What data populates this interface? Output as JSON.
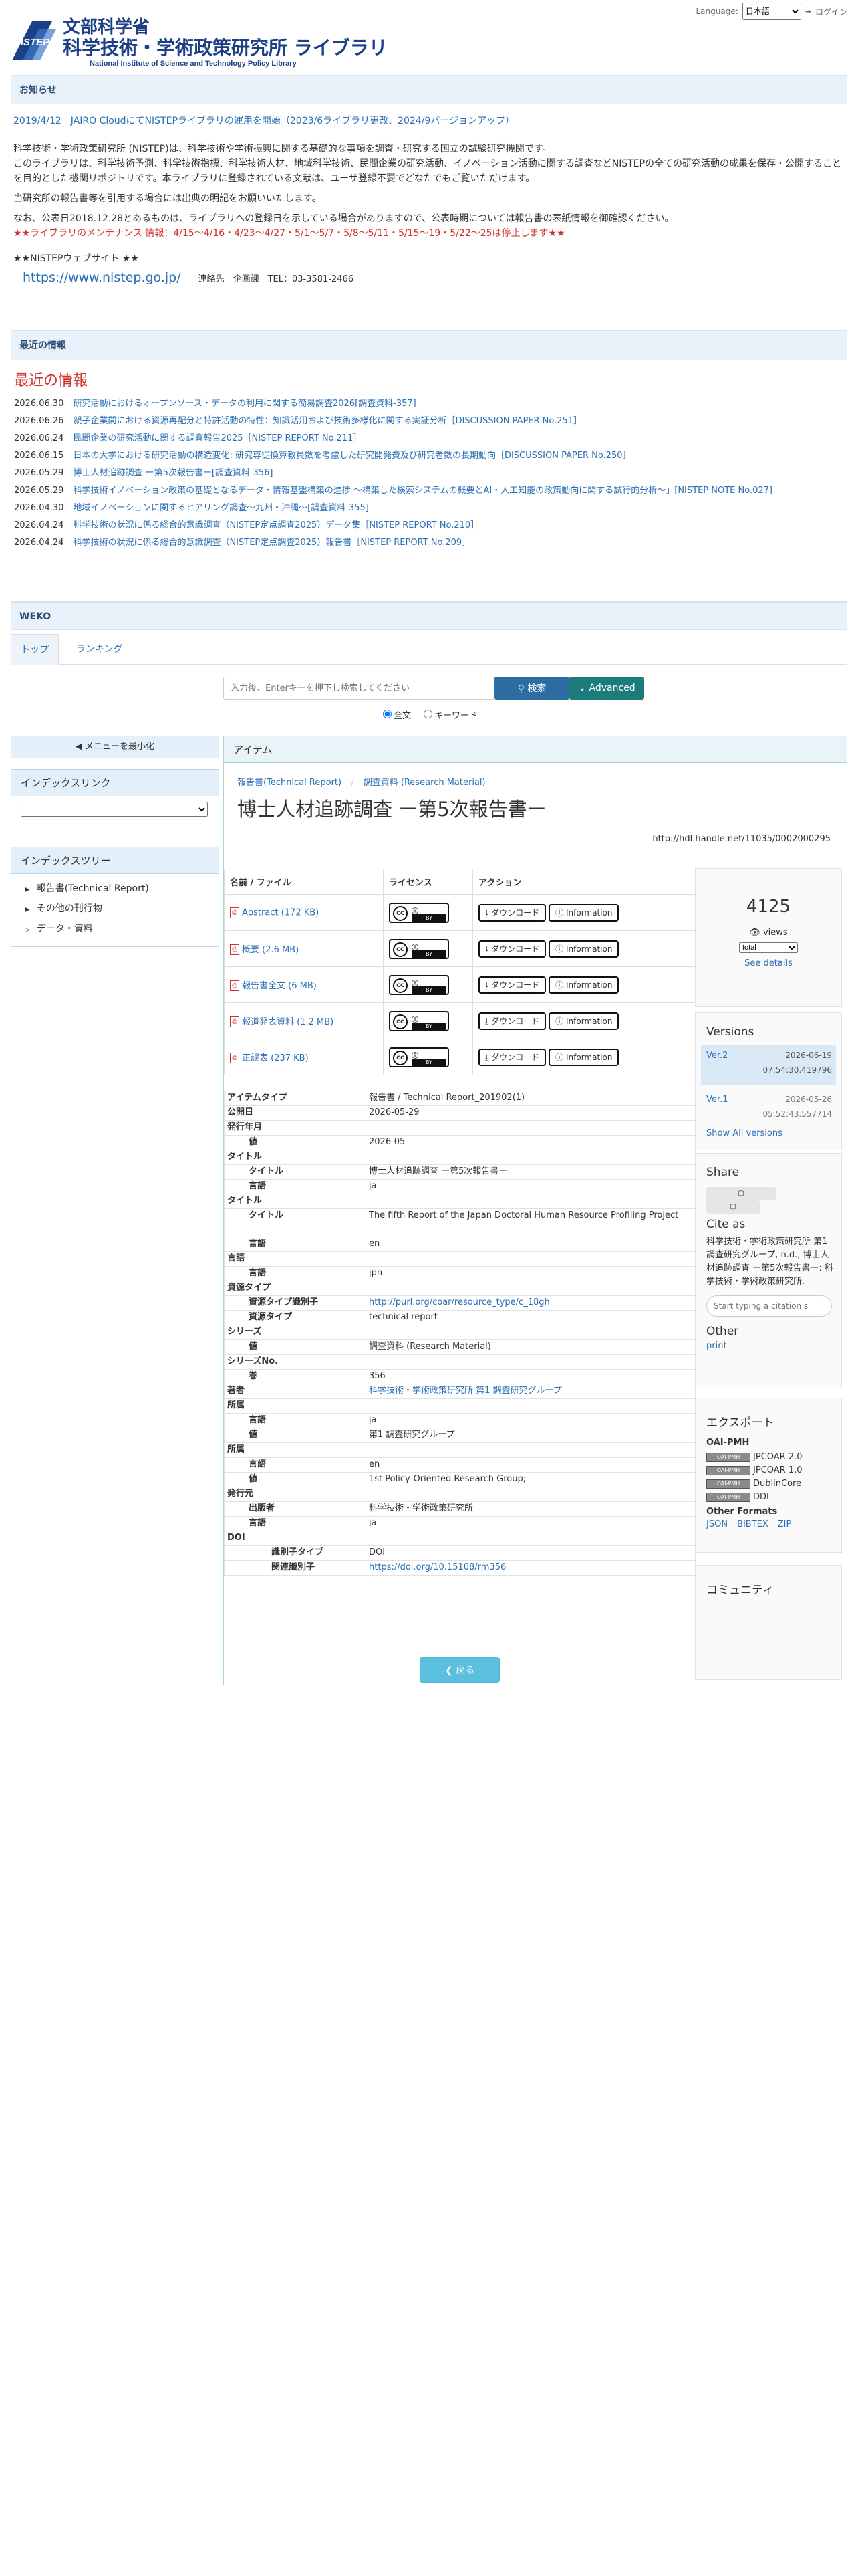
{
  "topbar": {
    "language_label": "Language:",
    "language_value": "日本語",
    "login": "ログイン"
  },
  "logo": {
    "line1": "文部科学省",
    "line2": "科学技術・学術政策研究所 ライブラリ",
    "line3": "National Institute of Science and Technology Policy Library"
  },
  "notice": {
    "heading": "お知らせ",
    "update": "2019/4/12　JAIRO CloudにてNISTEPライブラリの運用を開始（2023/6ライブラリ更改、2024/9バージョンアップ）",
    "desc1": "科学技術・学術政策研究所 (NISTEP)は、科学技術や学術振興に関する基礎的な事項を調査・研究する国立の試験研究機関です。",
    "desc2": "このライブラリは、科学技術予測、科学技術指標、科学技術人材、地域科学技術、民間企業の研究活動、イノベーション活動に関する調査などNISTEPの全ての研究活動の成果を保存・公開することを目的とした機関リポジトリです。本ライブラリに登録されている文献は、ユーザ登録不要でどなたでもご覧いただけます。",
    "desc3": "当研究所の報告書等を引用する場合には出典の明記をお願いいたします。",
    "desc4": "なお、公表日2018.12.28とあるものは、ライブラリへの登録日を示している場合がありますので、公表時期については報告書の表紙情報を御確認ください。",
    "maint": "★★ライブラリのメンテナンス 情報：4/15～4/16・4/23～4/27・5/1～5/7・5/8～5/11・5/15～19・5/22～25は停止します★★",
    "site_label": "★★NISTEPウェブサイト ★★",
    "site_url": "https://www.nistep.go.jp/",
    "contact": "連絡先　企画課　TEL：03-3581-2466"
  },
  "news": {
    "heading": "最近の情報",
    "title": "最近の情報",
    "items": [
      {
        "date": "2026.06.30",
        "text": "研究活動におけるオープンソース・データの利用に関する簡易調査2026[調査資料-357]"
      },
      {
        "date": "2026.06.26",
        "text": "親子企業間における資源再配分と特許活動の特性：知識活用および技術多様化に関する実証分析［DISCUSSION PAPER No.251］"
      },
      {
        "date": "2026.06.24",
        "text": "民間企業の研究活動に関する調査報告2025［NISTEP REPORT No.211］"
      },
      {
        "date": "2026.06.15",
        "text": "日本の大学における研究活動の構造変化: 研究専従換算教員数を考慮した研究開発費及び研究者数の長期動向［DISCUSSION PAPER No.250］"
      },
      {
        "date": "2026.05.29",
        "text": "博士人材追跡調査 ー第5次報告書ー[調査資料-356]"
      },
      {
        "date": "2026.05.29",
        "text": "科学技術イノベーション政策の基礎となるデータ・情報基盤構築の進捗 ～構築した検索システムの概要とAI・人工知能の政策動向に関する試行的分析～」[NISTEP NOTE No.027]"
      },
      {
        "date": "2026.04.30",
        "text": "地域イノベーションに関するヒアリング調査～九州・沖縄～[調査資料-355]"
      },
      {
        "date": "2026.04.24",
        "text": "科学技術の状況に係る総合的意識調査（NISTEP定点調査2025）データ集［NISTEP REPORT No.210］"
      },
      {
        "date": "2026.04.24",
        "text": "科学技術の状況に係る総合的意識調査（NISTEP定点調査2025）報告書［NISTEP REPORT No.209］"
      }
    ]
  },
  "weko": {
    "heading": "WEKO",
    "tabs": [
      "トップ",
      "ランキング"
    ]
  },
  "search": {
    "placeholder": "入力後、Enterキーを押下し検索してください",
    "button": "検索",
    "advanced": "Advanced",
    "radio1": "全文",
    "radio2": "キーワード"
  },
  "sidebar": {
    "collapse": "◀ メニューを最小化",
    "index_link": "インデックスリンク",
    "index_tree": "インデックスツリー",
    "tree": [
      "報告書(Technical Report)",
      "その他の刊行物",
      "データ・資料"
    ]
  },
  "item": {
    "heading": "アイテム",
    "breadcrumb": [
      "報告書(Technical Report)",
      "調査資料 (Research Material)"
    ],
    "title": "博士人材追跡調査 ー第5次報告書ー",
    "handle": "http://hdl.handle.net/11035/0002000295",
    "file_headers": [
      "名前 / ファイル",
      "ライセンス",
      "アクション"
    ],
    "files": [
      "Abstract (172 KB)",
      "概要 (2.6 MB)",
      "報告書全文 (6 MB)",
      "報道発表資料 (1.2 MB)",
      "正誤表 (237 KB)"
    ],
    "download": "ダウンロード",
    "information": "Information",
    "license_top": "BY",
    "metadata": [
      {
        "k": "アイテムタイプ",
        "v": "報告書 / Technical Report_201902(1)",
        "lvl": 1
      },
      {
        "k": "公開日",
        "v": "2026-05-29",
        "lvl": 1
      },
      {
        "k": "発行年月",
        "v": "",
        "lvl": 1
      },
      {
        "k": "値",
        "v": "2026-05",
        "lvl": 2
      },
      {
        "k": "タイトル",
        "v": "",
        "lvl": 1
      },
      {
        "k": "タイトル",
        "v": "博士人材追跡調査 ー第5次報告書ー",
        "lvl": 2
      },
      {
        "k": "言語",
        "v": "ja",
        "lvl": 2
      },
      {
        "k": "タイトル",
        "v": "",
        "lvl": 1
      },
      {
        "k": "タイトル",
        "v": "The fifth Report of the Japan Doctoral Human Resource Profiling Project",
        "lvl": 2,
        "tall": true
      },
      {
        "k": "言語",
        "v": "en",
        "lvl": 2
      },
      {
        "k": "言語",
        "v": "",
        "lvl": 1
      },
      {
        "k": "言語",
        "v": "jpn",
        "lvl": 2
      },
      {
        "k": "資源タイプ",
        "v": "",
        "lvl": 1
      },
      {
        "k": "資源タイプ識別子",
        "v": "http://purl.org/coar/resource_type/c_18gh",
        "lvl": 2,
        "link": true
      },
      {
        "k": "資源タイプ",
        "v": "technical report",
        "lvl": 2
      },
      {
        "k": "シリーズ",
        "v": "",
        "lvl": 1
      },
      {
        "k": "値",
        "v": "調査資料 (Research Material)",
        "lvl": 2
      },
      {
        "k": "シリーズNo.",
        "v": "",
        "lvl": 1
      },
      {
        "k": "巻",
        "v": "356",
        "lvl": 2
      },
      {
        "k": "著者",
        "v": "科学技術・学術政策研究所 第1 調査研究グループ",
        "lvl": 1,
        "link": true
      },
      {
        "k": "所属",
        "v": "",
        "lvl": 1
      },
      {
        "k": "言語",
        "v": "ja",
        "lvl": 2
      },
      {
        "k": "値",
        "v": "第1 調査研究グループ",
        "lvl": 2
      },
      {
        "k": "所属",
        "v": "",
        "lvl": 1
      },
      {
        "k": "言語",
        "v": "en",
        "lvl": 2
      },
      {
        "k": "値",
        "v": "1st Policy-Oriented Research Group;",
        "lvl": 2
      },
      {
        "k": "発行元",
        "v": "",
        "lvl": 1
      },
      {
        "k": "出版者",
        "v": "科学技術・学術政策研究所",
        "lvl": 2
      },
      {
        "k": "言語",
        "v": "ja",
        "lvl": 2
      },
      {
        "k": "DOI",
        "v": "",
        "lvl": 1
      },
      {
        "k": "識別子タイプ",
        "v": "DOI",
        "lvl": 3
      },
      {
        "k": "関連識別子",
        "v": "https://doi.org/10.15108/rm356",
        "lvl": 3,
        "link": true
      }
    ],
    "back": "戻る"
  },
  "stats": {
    "count": "4125",
    "views_label": "views",
    "select": "total",
    "see_details": "See details"
  },
  "versions": {
    "heading": "Versions",
    "v2": "Ver.2",
    "v2_date": "2026-06-19",
    "v2_time": "07:54:30.419796",
    "v1": "Ver.1",
    "v1_date": "2026-05-26",
    "v1_time": "05:52:43.557714",
    "show_all": "Show All versions"
  },
  "share": {
    "heading": "Share",
    "cite_heading": "Cite as",
    "cite_text": "科学技術・学術政策研究所 第1 調査研究グループ, n.d., 博士人材追跡調査 ー第5次報告書ー: 科学技術・学術政策研究所.",
    "cite_placeholder": "Start typing a citation s",
    "other": "Other",
    "print": "print"
  },
  "export": {
    "heading": "エクスポート",
    "oai": "OAI-PMH",
    "formats": [
      "JPCOAR 2.0",
      "JPCOAR 1.0",
      "DublinCore",
      "DDI"
    ],
    "badge": "OAI-PMH",
    "other_formats": "Other Formats",
    "links": [
      "JSON",
      "BIBTEX",
      "ZIP"
    ]
  },
  "community": {
    "heading": "コミュニティ"
  }
}
